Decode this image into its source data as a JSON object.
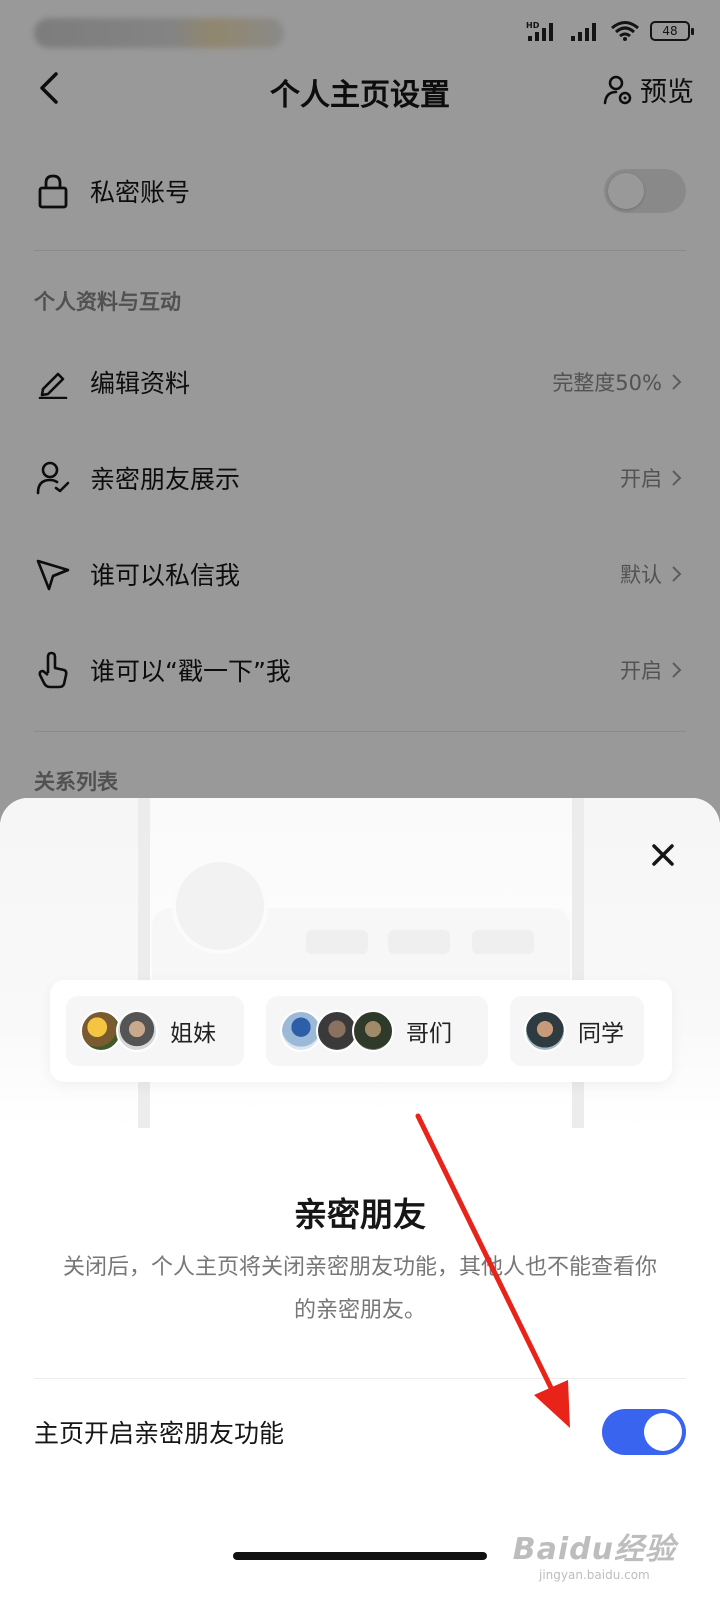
{
  "status_bar": {
    "battery": "48",
    "network": "HD"
  },
  "nav": {
    "title": "个人主页设置",
    "preview_label": "预览"
  },
  "privacy": {
    "label": "私密账号",
    "toggle_state": "off"
  },
  "section_profile": {
    "title": "个人资料与互动",
    "items": [
      {
        "label": "编辑资料",
        "value": "完整度50%",
        "icon": "edit-icon"
      },
      {
        "label": "亲密朋友展示",
        "value": "开启",
        "icon": "user-check-icon"
      },
      {
        "label": "谁可以私信我",
        "value": "默认",
        "icon": "send-icon"
      },
      {
        "label": "谁可以“戳一下”我",
        "value": "开启",
        "icon": "tap-hand-icon"
      }
    ]
  },
  "section_relations": {
    "title": "关系列表"
  },
  "sheet": {
    "chips": [
      {
        "label": "姐妹",
        "avatar_count": 2
      },
      {
        "label": "哥们",
        "avatar_count": 3
      },
      {
        "label": "同学",
        "avatar_count": 1
      }
    ],
    "title": "亲密朋友",
    "description": "关闭后，个人主页将关闭亲密朋友功能，其他人也不能查看你的亲密朋友。",
    "feature_toggle": {
      "label": "主页开启亲密朋友功能",
      "state": "on"
    }
  },
  "colors": {
    "accent": "#3864f0",
    "annotation": "#e8231a",
    "dim_overlay": "rgba(0,0,0,0.40)"
  },
  "watermark": {
    "logo": "Baidu经验",
    "sub": "jingyan.baidu.com"
  }
}
